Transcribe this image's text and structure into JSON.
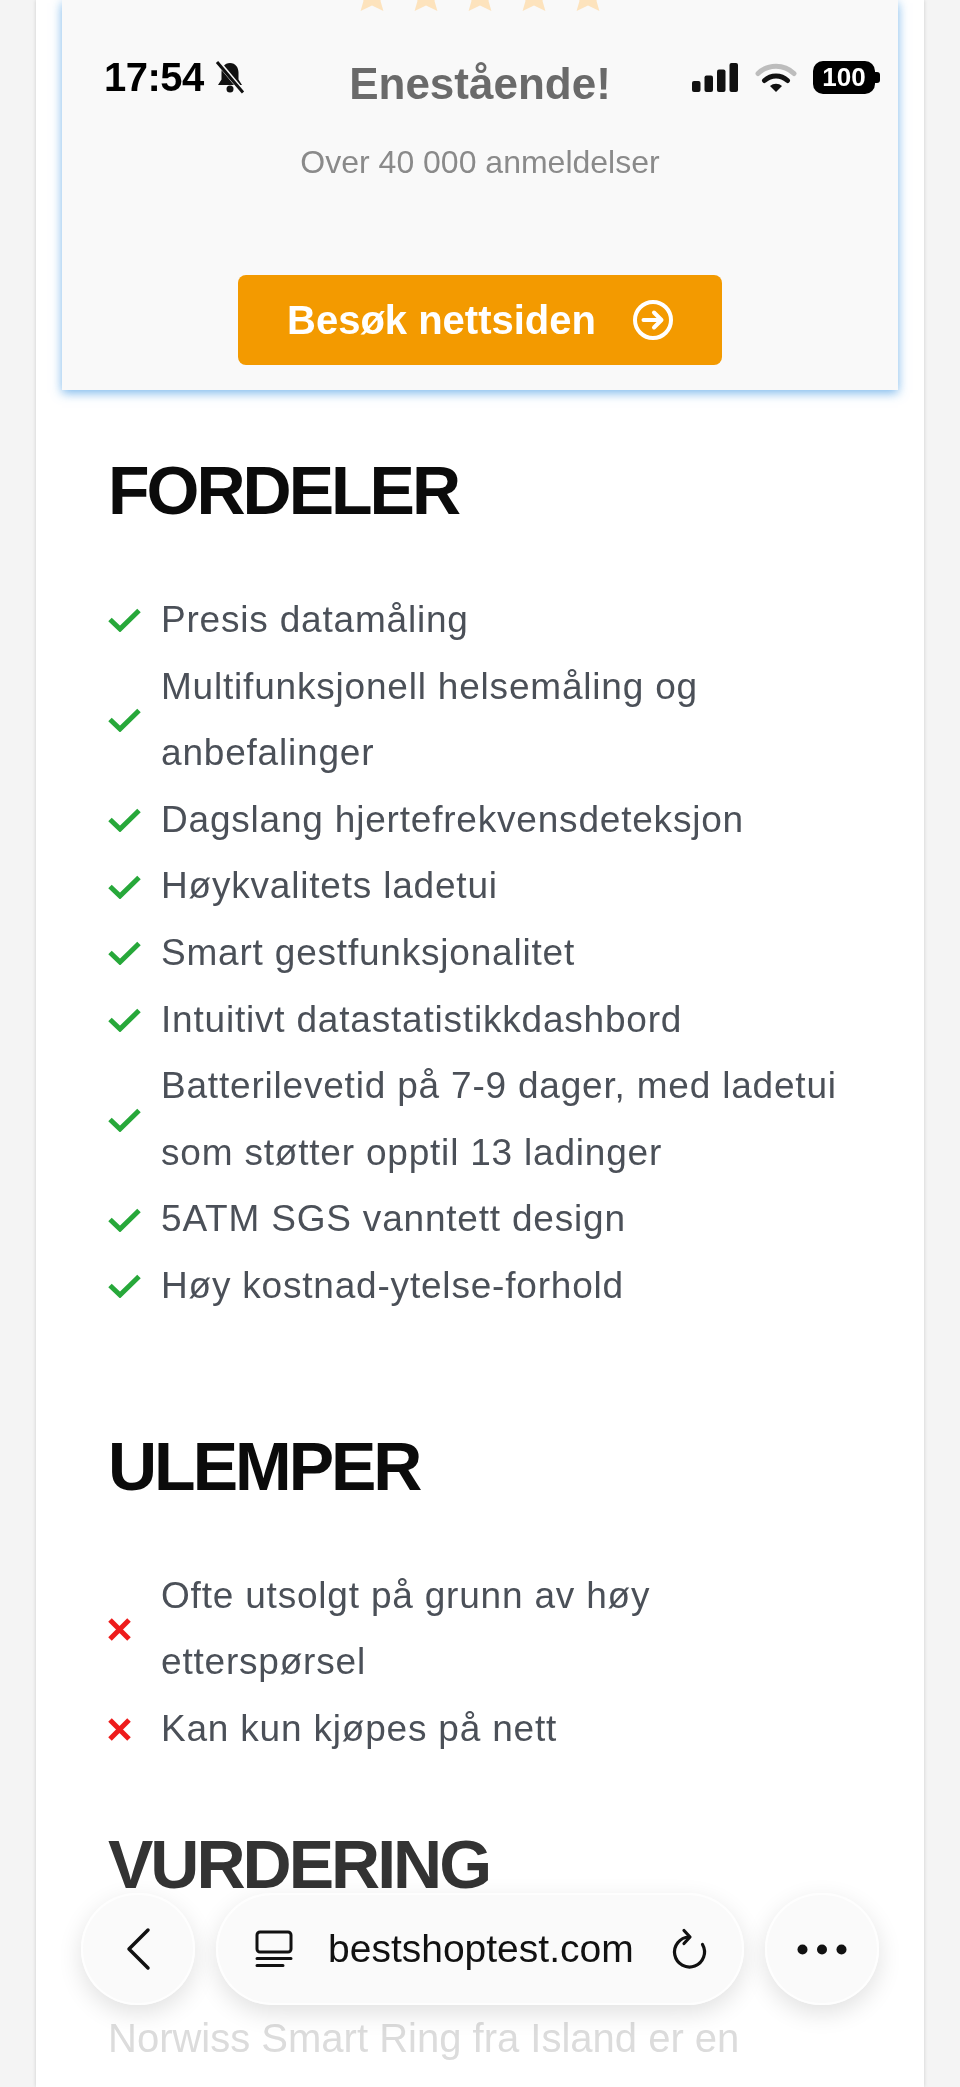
{
  "status_bar": {
    "time": "17:54",
    "battery": "100"
  },
  "card": {
    "rating": {
      "stars": 5
    },
    "title": "Enestående!",
    "subtitle": "Over 40 000 anmeldelser",
    "button": "Besøk nettsiden"
  },
  "sections": [
    {
      "kind": "pros",
      "heading": "FORDELER",
      "items": [
        "Presis datamåling",
        "Multifunksjonell helsemåling og anbefalinger",
        "Dagslang hjertefrekvensdeteksjon",
        "Høykvalitets ladetui",
        "Smart gestfunksjonalitet",
        "Intuitivt datastatistikkdashbord",
        "Batterilevetid på 7-9 dager, med ladetui som støtter opptil 13 ladinger",
        "5ATM SGS vanntett design",
        "Høy kostnad-ytelse-forhold"
      ]
    },
    {
      "kind": "cons",
      "heading": "ULEMPER",
      "items": [
        "Ofte utsolgt på grunn av høy etterspørsel",
        "Kan kun kjøpes på nett"
      ]
    },
    {
      "kind": "text",
      "heading": "VURDERING",
      "paragraph": "Norwiss Smart Ring fra Island er en"
    }
  ],
  "browser_bar": {
    "url": "bestshoptest.com"
  }
}
